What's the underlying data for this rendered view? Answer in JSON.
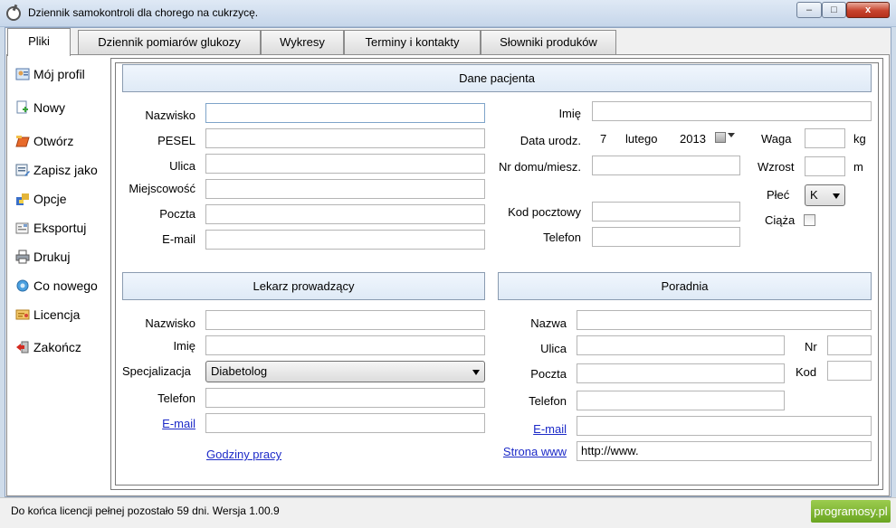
{
  "window": {
    "title": "Dziennik samokontroli dla chorego na cukrzycę.",
    "min_glyph": "‒",
    "max_glyph": "□",
    "close_glyph": "x"
  },
  "tabs": [
    {
      "label": "Pliki",
      "active": true
    },
    {
      "label": "Dziennik pomiarów glukozy"
    },
    {
      "label": "Wykresy"
    },
    {
      "label": "Terminy i kontakty"
    },
    {
      "label": "Słowniki produków"
    }
  ],
  "sidebar": [
    {
      "label": "Mój profil",
      "icon": "profile-icon"
    },
    {
      "label": "Nowy",
      "icon": "new-file-icon"
    },
    {
      "label": "Otwórz",
      "icon": "open-icon"
    },
    {
      "label": "Zapisz jako",
      "icon": "save-as-icon"
    },
    {
      "label": "Opcje",
      "icon": "options-icon"
    },
    {
      "label": "Eksportuj",
      "icon": "export-icon"
    },
    {
      "label": "Drukuj",
      "icon": "print-icon"
    },
    {
      "label": "Co nowego",
      "icon": "whats-new-icon"
    },
    {
      "label": "Licencja",
      "icon": "license-icon"
    },
    {
      "label": "Zakończ",
      "icon": "exit-icon"
    }
  ],
  "patient": {
    "header": "Dane pacjenta",
    "nazwisko": "Nazwisko",
    "pesel": "PESEL",
    "ulica": "Ulica",
    "miejscowosc": "Miejscowość",
    "poczta": "Poczta",
    "email": "E-mail",
    "imie": "Imię",
    "data_urodz": "Data urodz.",
    "date_day": "7",
    "date_month": "lutego",
    "date_year": "2013",
    "nr_domu": "Nr domu/miesz.",
    "kod_pocztowy": "Kod pocztowy",
    "telefon": "Telefon",
    "waga": "Waga",
    "waga_unit": "kg",
    "wzrost": "Wzrost",
    "wzrost_unit": "m",
    "plec": "Płeć",
    "plec_value": "K",
    "ciaza": "Ciąża"
  },
  "doctor": {
    "header": "Lekarz prowadzący",
    "nazwisko": "Nazwisko",
    "imie": "Imię",
    "specjalizacja": "Specjalizacja",
    "specjalizacja_value": "Diabetolog",
    "telefon": "Telefon",
    "email": "E-mail",
    "godziny": "Godziny pracy"
  },
  "clinic": {
    "header": "Poradnia",
    "nazwa": "Nazwa",
    "ulica": "Ulica",
    "nr": "Nr",
    "poczta": "Poczta",
    "kod": "Kod",
    "telefon": "Telefon",
    "email": "E-mail",
    "strona": "Strona www",
    "strona_value": "http://www."
  },
  "status": {
    "text": "Do końca licencji pełnej pozostało 59 dni.  Wersja 1.00.9",
    "brand": "programosy.pl"
  }
}
